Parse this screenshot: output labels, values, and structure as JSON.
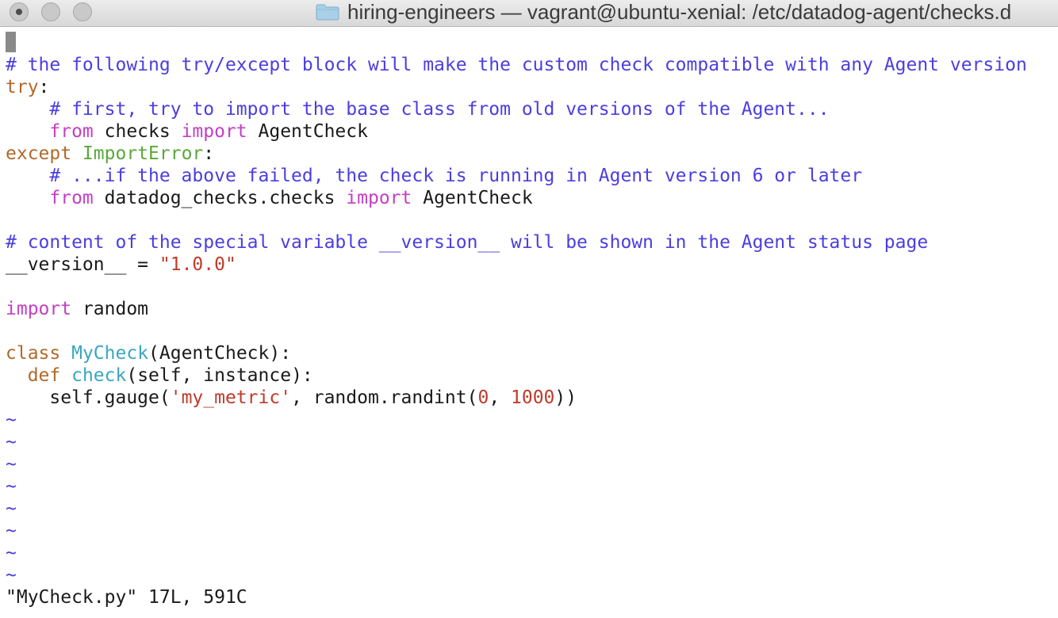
{
  "window": {
    "title": "hiring-engineers — vagrant@ubuntu-xenial: /etc/datadog-agent/checks.d",
    "folder_icon": "folder-icon"
  },
  "colors": {
    "comment": "#4b3ee0",
    "keyword": "#b06a2a",
    "import_kw": "#c440c4",
    "exception": "#5aa83a",
    "string": "#bf3b2a",
    "function_name": "#3aa7bd"
  },
  "editor": {
    "lines": [
      [
        {
          "t": "# the following try/except block will make the custom check compatible with any Agent version",
          "c": "comment"
        }
      ],
      [
        {
          "t": "try",
          "c": "keyword"
        },
        {
          "t": ":",
          "c": "plain"
        }
      ],
      [
        {
          "t": "    # first, try to import the base class from old versions of the Agent...",
          "c": "comment"
        }
      ],
      [
        {
          "t": "    ",
          "c": "plain"
        },
        {
          "t": "from",
          "c": "import"
        },
        {
          "t": " checks ",
          "c": "plain"
        },
        {
          "t": "import",
          "c": "import"
        },
        {
          "t": " AgentCheck",
          "c": "plain"
        }
      ],
      [
        {
          "t": "except",
          "c": "keyword"
        },
        {
          "t": " ",
          "c": "plain"
        },
        {
          "t": "ImportError",
          "c": "exception"
        },
        {
          "t": ":",
          "c": "plain"
        }
      ],
      [
        {
          "t": "    # ...if the above failed, the check is running in Agent version 6 or later",
          "c": "comment"
        }
      ],
      [
        {
          "t": "    ",
          "c": "plain"
        },
        {
          "t": "from",
          "c": "import"
        },
        {
          "t": " datadog_checks.checks ",
          "c": "plain"
        },
        {
          "t": "import",
          "c": "import"
        },
        {
          "t": " AgentCheck",
          "c": "plain"
        }
      ],
      [],
      [
        {
          "t": "# content of the special variable __version__ will be shown in the Agent status page",
          "c": "comment"
        }
      ],
      [
        {
          "t": "__version__ = ",
          "c": "plain"
        },
        {
          "t": "\"1.0.0\"",
          "c": "string"
        }
      ],
      [],
      [
        {
          "t": "import",
          "c": "import"
        },
        {
          "t": " random",
          "c": "plain"
        }
      ],
      [],
      [
        {
          "t": "class",
          "c": "keyword"
        },
        {
          "t": " ",
          "c": "plain"
        },
        {
          "t": "MyCheck",
          "c": "func"
        },
        {
          "t": "(AgentCheck):",
          "c": "plain"
        }
      ],
      [
        {
          "t": "  ",
          "c": "plain"
        },
        {
          "t": "def",
          "c": "keyword"
        },
        {
          "t": " ",
          "c": "plain"
        },
        {
          "t": "check",
          "c": "func"
        },
        {
          "t": "(self, instance):",
          "c": "plain"
        }
      ],
      [
        {
          "t": "    self.gauge(",
          "c": "plain"
        },
        {
          "t": "'my_metric'",
          "c": "string"
        },
        {
          "t": ", random.randint(",
          "c": "plain"
        },
        {
          "t": "0",
          "c": "number"
        },
        {
          "t": ", ",
          "c": "plain"
        },
        {
          "t": "1000",
          "c": "number"
        },
        {
          "t": "))",
          "c": "plain"
        }
      ],
      [
        {
          "t": "~",
          "c": "tilde"
        }
      ],
      [
        {
          "t": "~",
          "c": "tilde"
        }
      ],
      [
        {
          "t": "~",
          "c": "tilde"
        }
      ],
      [
        {
          "t": "~",
          "c": "tilde"
        }
      ],
      [
        {
          "t": "~",
          "c": "tilde"
        }
      ],
      [
        {
          "t": "~",
          "c": "tilde"
        }
      ],
      [
        {
          "t": "~",
          "c": "tilde"
        }
      ],
      [
        {
          "t": "~",
          "c": "tilde"
        }
      ]
    ],
    "status_line": "\"MyCheck.py\" 17L, 591C"
  }
}
